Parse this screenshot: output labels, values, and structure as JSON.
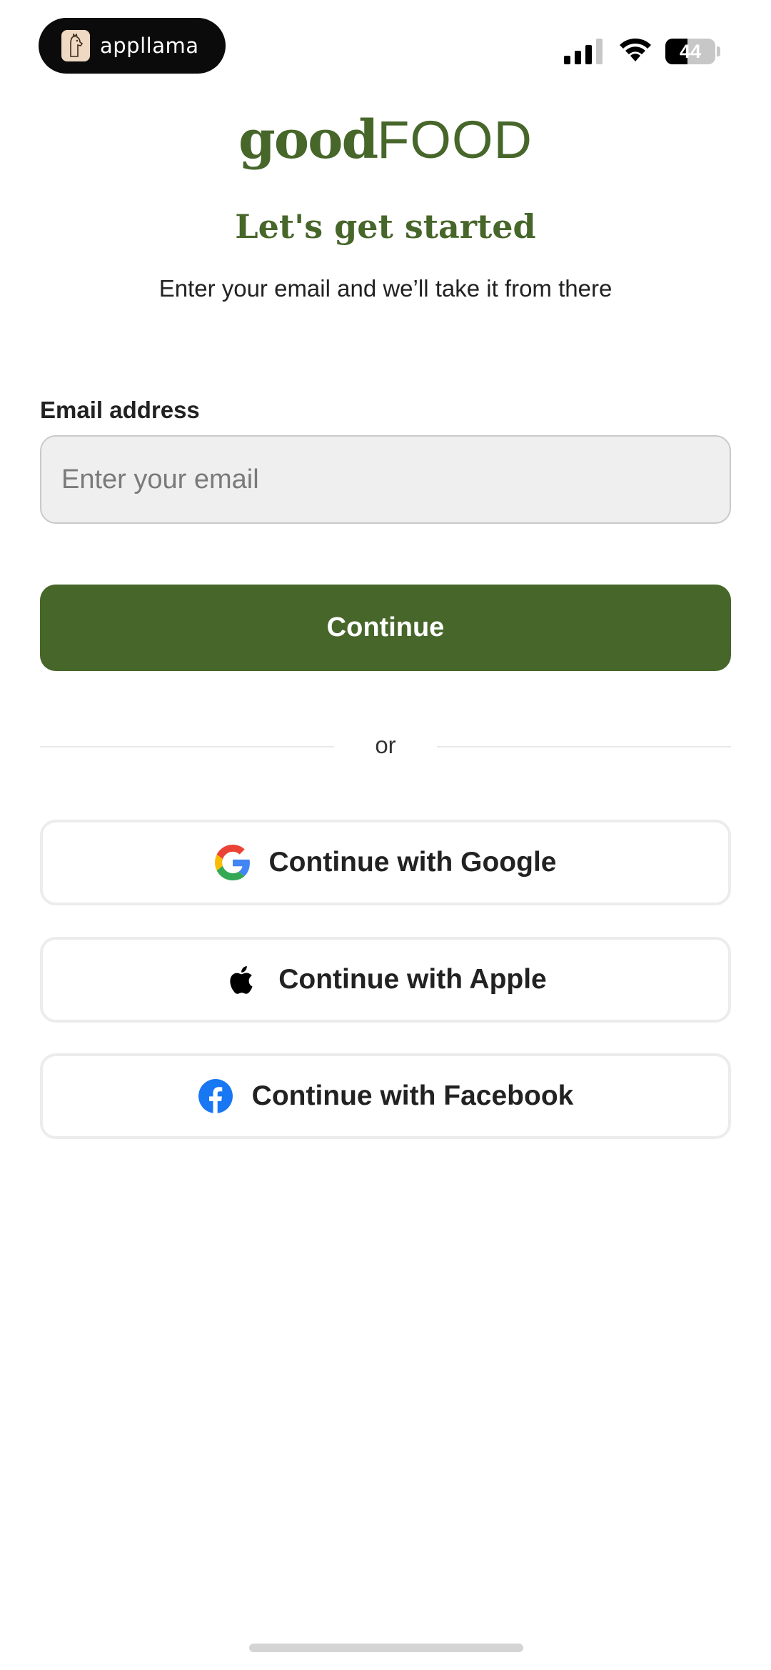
{
  "status_bar": {
    "app_name": "appllama",
    "battery_level": "44",
    "battery_fraction": 0.44
  },
  "brand": {
    "part1": "good",
    "part2": "FOOD"
  },
  "heading": "Let's get started",
  "subheading": "Enter your email and we’ll take it from there",
  "form": {
    "email_label": "Email address",
    "email_placeholder": "Enter your email",
    "email_value": "",
    "continue_label": "Continue"
  },
  "divider_text": "or",
  "social": {
    "google_label": "Continue with Google",
    "apple_label": "Continue with Apple",
    "facebook_label": "Continue with Facebook"
  },
  "icons": {
    "app_logo": "llama-logo-icon",
    "signal": "cellular-signal-icon",
    "wifi": "wifi-icon",
    "google": "google-icon",
    "apple": "apple-icon",
    "facebook": "facebook-icon"
  },
  "colors": {
    "brand_green": "#47662a",
    "google_blue": "#4285F4",
    "google_red": "#EA4335",
    "google_yellow": "#FBBC05",
    "google_green": "#34A853",
    "facebook_blue": "#1877F2"
  }
}
